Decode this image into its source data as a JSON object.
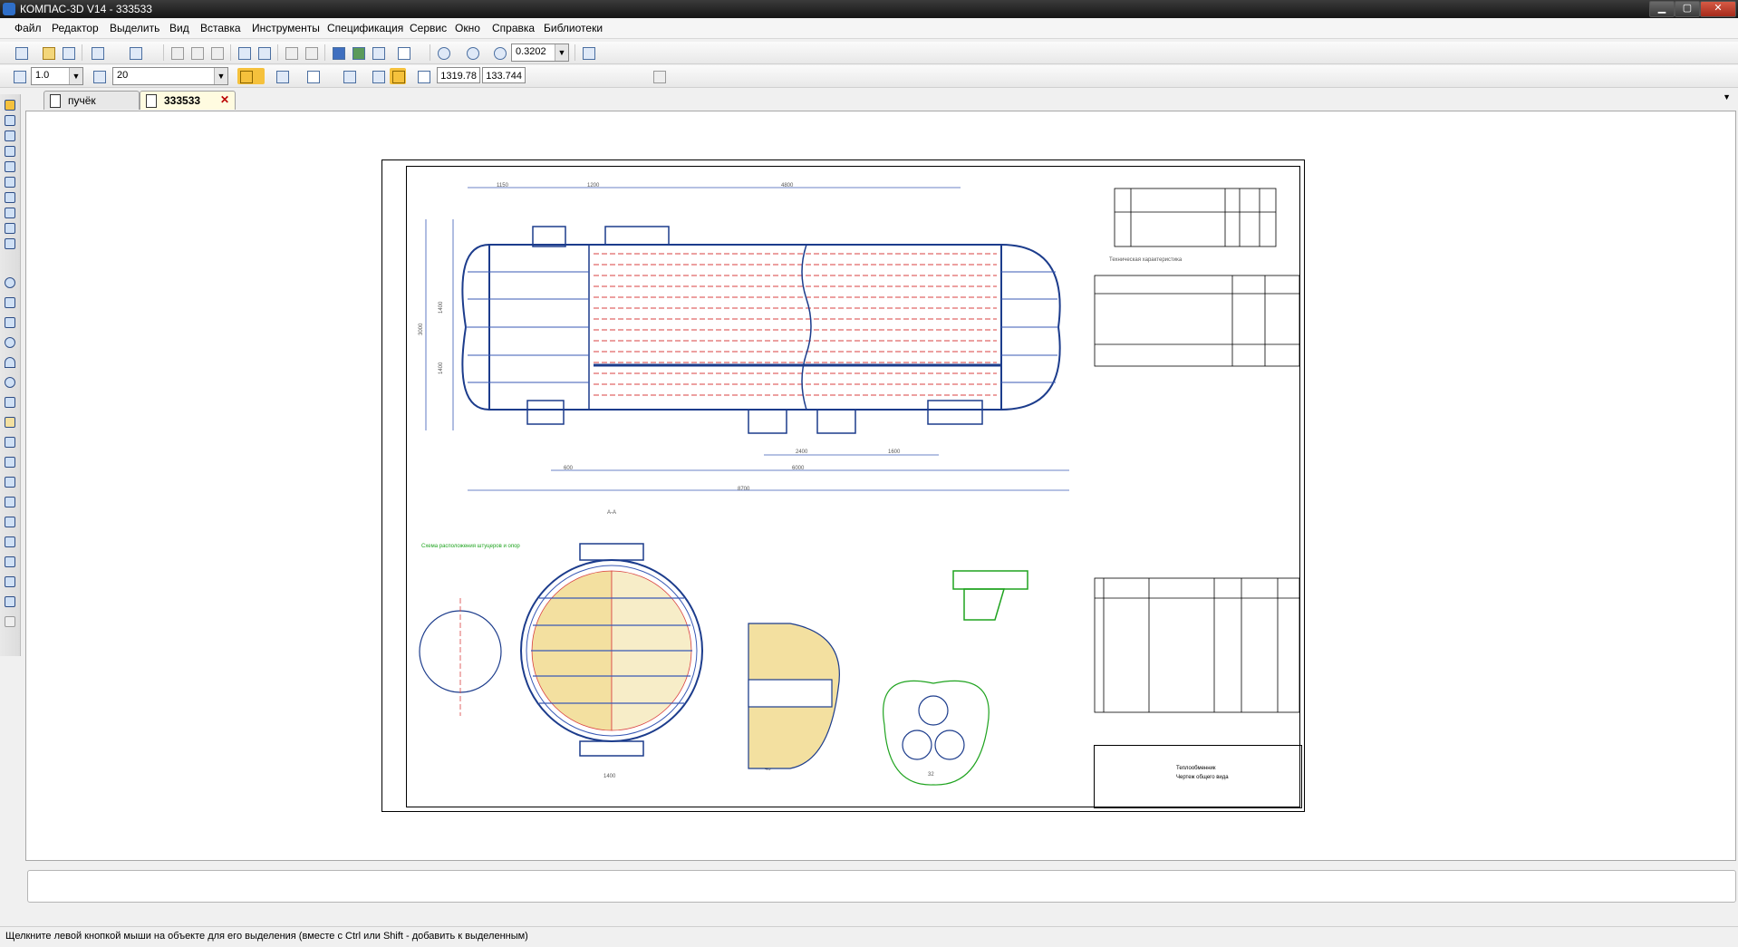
{
  "window": {
    "title": "КОМПАС-3D V14 - 333533",
    "controls": {
      "minimize": "▁",
      "maximize": "▢",
      "close": "✕"
    }
  },
  "menu": {
    "items": [
      {
        "label": "Файл"
      },
      {
        "label": "Редактор"
      },
      {
        "label": "Выделить"
      },
      {
        "label": "Вид"
      },
      {
        "label": "Вставка"
      },
      {
        "label": "Инструменты"
      },
      {
        "label": "Спецификация"
      },
      {
        "label": "Сервис"
      },
      {
        "label": "Окно"
      },
      {
        "label": "Справка"
      },
      {
        "label": "Библиотеки"
      }
    ]
  },
  "toolbar1": {
    "icons": [
      "new-document-icon",
      "open-icon",
      "save-icon",
      "print-icon",
      "preview-icon",
      "cut-icon",
      "copy-icon",
      "paste-icon",
      "properties-icon",
      "manager-icon",
      "undo-icon",
      "redo-icon",
      "manager-documents-icon",
      "library-icon",
      "variables-icon",
      "help-pointer-icon",
      "zoom-window-icon",
      "zoom-out-icon",
      "zoom-in-icon",
      "refresh-icon"
    ],
    "zoom_value": "0.3202"
  },
  "toolbar2": {
    "step_value": "1.0",
    "layer_value": "20",
    "coord_x": "1319.78",
    "coord_y": "133.744"
  },
  "tabs": [
    {
      "label": "пучёк",
      "active": false
    },
    {
      "label": "333533",
      "active": true,
      "close": "✕"
    }
  ],
  "left_tools": [
    "geometry-icon",
    "dimensions-icon",
    "notation-icon",
    "editing-icon",
    "parametrization-icon",
    "measure-icon",
    "select-icon",
    "report-icon",
    "spec-icon",
    "point-icon",
    "line-icon",
    "circle-icon",
    "arc-icon",
    "ellipse-icon",
    "spline-icon",
    "hatch-icon",
    "rectangle-icon",
    "polygon-icon",
    "chamfer-icon",
    "fillet-icon",
    "offset-icon",
    "fragment-icon",
    "macro-icon",
    "view-icon"
  ],
  "drawing": {
    "sheet_title": "Теплообменник",
    "sheet_subtitle": "Чертеж общего вида",
    "dims": [
      "1150",
      "1200",
      "4800",
      "1400",
      "1400",
      "3000",
      "2400",
      "1600",
      "600",
      "6000",
      "8700",
      "1400",
      "40",
      "32"
    ],
    "section_label": "А-А",
    "tech_table_title": "Техническая характеристика",
    "nozzle_scheme_label": "Схема расположения штуцеров и опор"
  },
  "status": {
    "hint": "Щелкните левой кнопкой мыши на объекте для его выделения (вместе с Ctrl или Shift - добавить к выделенным)"
  },
  "colors": {
    "accent_blue": "#1c3c8c",
    "dimension_blue": "#3a5ab5",
    "tube_red": "#d94040",
    "fill_yellow": "#f3e0a0",
    "green_detail": "#1fa31f"
  }
}
